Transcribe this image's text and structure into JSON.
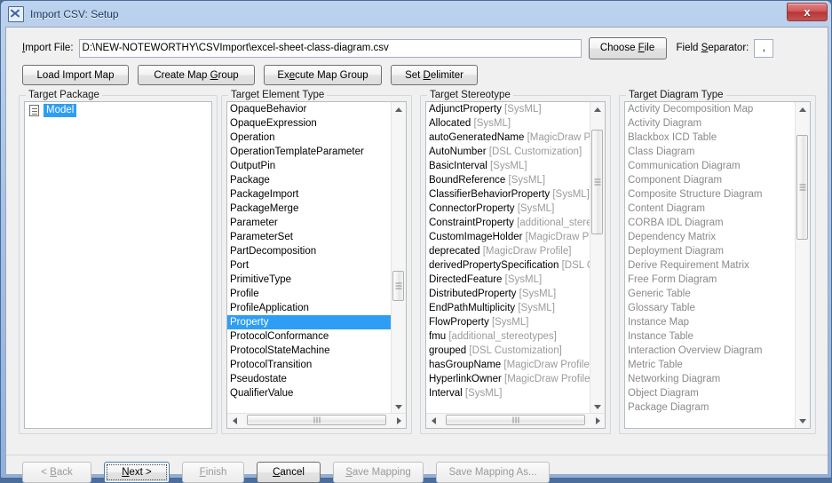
{
  "window": {
    "title": "Import CSV: Setup",
    "icon": "app-icon",
    "close_label": "x",
    "accent_selection": "#2e9ef4",
    "titlebar_color": "#a9c4e8"
  },
  "form": {
    "import_file_label": "Import File:",
    "import_file_value": "D:\\NEW-NOTEWORTHY\\CSVImport\\excel-sheet-class-diagram.csv",
    "choose_file_label": "Choose File",
    "field_separator_label": "Field Separator:",
    "field_separator_value": ","
  },
  "map_buttons": [
    {
      "label": "Load Import Map",
      "enabled": true
    },
    {
      "label": "Create Map Group",
      "enabled": true
    },
    {
      "label": "Execute Map Group",
      "enabled": true
    },
    {
      "label": "Set Delimiter",
      "enabled": true
    }
  ],
  "panels": {
    "target_package": {
      "legend": "Target Package",
      "tree": [
        {
          "label": "Model",
          "icon": "document-icon",
          "selected": true
        }
      ]
    },
    "target_element_type": {
      "legend": "Target Element Type",
      "items": [
        {
          "name": "OpaqueBehavior"
        },
        {
          "name": "OpaqueExpression"
        },
        {
          "name": "Operation"
        },
        {
          "name": "OperationTemplateParameter"
        },
        {
          "name": "OutputPin"
        },
        {
          "name": "Package"
        },
        {
          "name": "PackageImport"
        },
        {
          "name": "PackageMerge"
        },
        {
          "name": "Parameter"
        },
        {
          "name": "ParameterSet"
        },
        {
          "name": "PartDecomposition"
        },
        {
          "name": "Port"
        },
        {
          "name": "PrimitiveType"
        },
        {
          "name": "Profile"
        },
        {
          "name": "ProfileApplication"
        },
        {
          "name": "Property",
          "selected": true
        },
        {
          "name": "ProtocolConformance"
        },
        {
          "name": "ProtocolStateMachine"
        },
        {
          "name": "ProtocolTransition"
        },
        {
          "name": "Pseudostate"
        },
        {
          "name": "QualifierValue"
        }
      ],
      "scroll": {
        "vertical_thumb_pct": 64,
        "horizontal_thumb_pct": 50
      }
    },
    "target_stereotype": {
      "legend": "Target Stereotype",
      "items": [
        {
          "name": "AdjunctProperty",
          "suffix": "[SysML]"
        },
        {
          "name": "Allocated",
          "suffix": "[SysML]"
        },
        {
          "name": "autoGeneratedName",
          "suffix": "[MagicDraw Profile"
        },
        {
          "name": "AutoNumber",
          "suffix": "[DSL Customization]"
        },
        {
          "name": "BasicInterval",
          "suffix": "[SysML]"
        },
        {
          "name": "BoundReference",
          "suffix": "[SysML]"
        },
        {
          "name": "ClassifierBehaviorProperty",
          "suffix": "[SysML]"
        },
        {
          "name": "ConnectorProperty",
          "suffix": "[SysML]"
        },
        {
          "name": "ConstraintProperty",
          "suffix": "[additional_stereot"
        },
        {
          "name": "CustomImageHolder",
          "suffix": "[MagicDraw Profile"
        },
        {
          "name": "deprecated",
          "suffix": "[MagicDraw Profile]"
        },
        {
          "name": "derivedPropertySpecification",
          "suffix": "[DSL Cust"
        },
        {
          "name": "DirectedFeature",
          "suffix": "[SysML]"
        },
        {
          "name": "DistributedProperty",
          "suffix": "[SysML]"
        },
        {
          "name": "EndPathMultiplicity",
          "suffix": "[SysML]"
        },
        {
          "name": "FlowProperty",
          "suffix": "[SysML]"
        },
        {
          "name": "fmu",
          "suffix": "[additional_stereotypes]"
        },
        {
          "name": "grouped",
          "suffix": "[DSL Customization]"
        },
        {
          "name": "hasGroupName",
          "suffix": "[MagicDraw Profile]"
        },
        {
          "name": "HyperlinkOwner",
          "suffix": "[MagicDraw Profile]"
        },
        {
          "name": "Interval",
          "suffix": "[SysML]"
        }
      ],
      "scroll": {
        "vertical_thumb_pct": 8,
        "horizontal_thumb_pct": 50
      }
    },
    "target_diagram_type": {
      "legend": "Target Diagram Type",
      "disabled": true,
      "items": [
        {
          "name": "Activity Decomposition Map"
        },
        {
          "name": "Activity Diagram"
        },
        {
          "name": "Blackbox ICD Table"
        },
        {
          "name": "Class Diagram"
        },
        {
          "name": "Communication Diagram"
        },
        {
          "name": "Component Diagram"
        },
        {
          "name": "Composite Structure Diagram"
        },
        {
          "name": "Content Diagram"
        },
        {
          "name": "CORBA IDL Diagram"
        },
        {
          "name": "Dependency Matrix"
        },
        {
          "name": "Deployment Diagram"
        },
        {
          "name": "Derive Requirement Matrix"
        },
        {
          "name": "Free Form Diagram"
        },
        {
          "name": "Generic Table"
        },
        {
          "name": "Glossary Table"
        },
        {
          "name": "Instance Map"
        },
        {
          "name": "Instance Table"
        },
        {
          "name": "Interaction Overview Diagram"
        },
        {
          "name": "Metric Table"
        },
        {
          "name": "Networking Diagram"
        },
        {
          "name": "Object Diagram"
        },
        {
          "name": "Package Diagram"
        }
      ],
      "scroll": {
        "vertical_thumb_pct": 10
      }
    }
  },
  "footer_buttons": [
    {
      "label": "< Back",
      "enabled": false,
      "focused": false
    },
    {
      "label": "Next >",
      "enabled": true,
      "focused": true
    },
    {
      "label": "Finish",
      "enabled": false,
      "focused": false
    },
    {
      "label": "Cancel",
      "enabled": true,
      "focused": false
    },
    {
      "label": "Save Mapping",
      "enabled": false,
      "focused": false
    },
    {
      "label": "Save Mapping As...",
      "enabled": false,
      "focused": false
    }
  ]
}
